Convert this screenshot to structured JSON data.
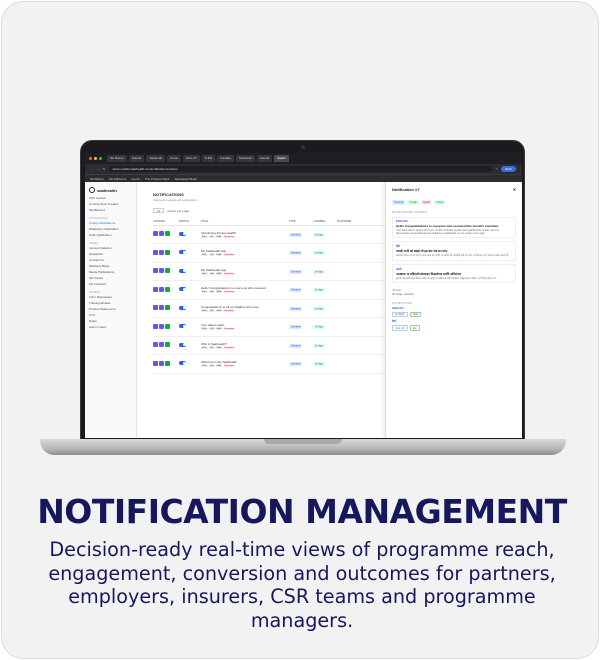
{
  "heading": "NOTIFICATION MANAGEMENT",
  "description": "Decision-ready real-time views of programme reach, engagement, conversion and outcomes for partners, employers, insurers, CSR teams and programme managers.",
  "browser": {
    "tabs": [
      "SH Basics",
      "Nebula",
      "Saathealt",
      "Home",
      "Zoho Pr",
      "S-Bar",
      "DevsBa",
      "Saathealt",
      "Nebula",
      "Saathi"
    ],
    "url": "admin.saathi.saathealth.com/notifications/notices",
    "work_label": "Work",
    "bookmarks": [
      "SH Basics",
      "SH Platforms",
      "Docks",
      "The Product Plank",
      "SaatHealth Bank"
    ]
  },
  "sidebar": {
    "logo": "saathealth",
    "items_top": [
      "CSV Upload",
      "Coming Soon Creator",
      "SH Banners"
    ],
    "group_notif": "NOTIFICATION",
    "items_notif": [
      "In-App Notifications",
      "WhatsApp Notification",
      "Push Notification"
    ],
    "group_users": "USERS",
    "items_users": [
      "Account Deletion",
      "Newsletter",
      "Contact Us",
      "Wellness Blogs",
      "Media Publications",
      "SH Impact",
      "SH Investors"
    ],
    "group_other": "OTHERS",
    "items_other": [
      "Form Responses",
      "Training Module",
      "Product Statements",
      "KYC",
      "Roles",
      "Admin Users"
    ]
  },
  "main": {
    "title": "NOTIFICATIONS",
    "subtitle": "View and manage all notifications",
    "per_page_value": "10",
    "per_page_label": "entries per page",
    "columns": [
      "ACTIONS",
      "STATUS",
      "TITLE",
      "TYPE",
      "CHANNEL",
      "PLATFORM"
    ],
    "rows": [
      {
        "title": "Introducing Pocket Health!",
        "type": "General",
        "channel": "In-App"
      },
      {
        "title": "My Saathealth App",
        "type": "General",
        "channel": "In-App"
      },
      {
        "title": "My Saathealth App",
        "type": "General",
        "channel": "In-App"
      },
      {
        "title": "Hello! Congratulations to everyone who received",
        "type": "General",
        "channel": "In-App"
      },
      {
        "title": "Congratulations to all our Saathis who recei",
        "type": "General",
        "channel": "In-App"
      },
      {
        "title": "Your data is safe!",
        "type": "General",
        "channel": "In-App"
      },
      {
        "title": "Who is Saathealth?",
        "type": "General",
        "channel": "In-App"
      },
      {
        "title": "Welcome to My Saathealth",
        "type": "General",
        "channel": "In-App"
      }
    ],
    "chip_labels": [
      "ENG",
      "HIN",
      "MAR",
      "Reminder"
    ]
  },
  "panel": {
    "title": "Notification #7",
    "tags": [
      "General",
      "In-App",
      "Saathi",
      "Active"
    ],
    "content_heading": "NOTIFICATION CONTENT",
    "langs": [
      {
        "name": "ENGLISH",
        "title": "Hello! Congratulations to everyone who received this month's incentive.",
        "body": "Your hard work is paying off! If you couldn't onboard people who qualified this month, don't be discouraged. Keep sharing and updating to Saathealth on our system every day."
      },
      {
        "name": "हिंदी",
        "title": "नमस्ते! सभी को बधाई जो इस बार पात्र बन पाए!",
        "body": "आपकी मेहनत रंग ला रही है! अगर आप इस महीने नए लोगों को ऑनबोर्ड नहीं कर पाए, तो निराश न हों। रोज़ाना साझा करते रहें।"
      },
      {
        "name": "मराठी",
        "title": "नमस्कार! या महिन्याचे प्रोत्साहन मिळालेल्या सर्वांचे अभिनंदन!",
        "body": "तुमच्या मेहनतीचे फळ मिळत आहे! जर तुम्ही या महिन्यात नवीन लोकांना जोडू शकला नाहीत, तर निराश होऊ नका."
      }
    ],
    "image_heading": "IMAGE",
    "image_note": "No image uploaded",
    "cta_heading": "CTA BUTTONS",
    "cta_english": "ENGLISH",
    "cta_btn1": "Go Back",
    "cta_btn2": "Okay",
    "cta_hindi": "हिंदी",
    "cta_hin1": "वापस जाएं",
    "cta_hin2": "ठीक"
  }
}
